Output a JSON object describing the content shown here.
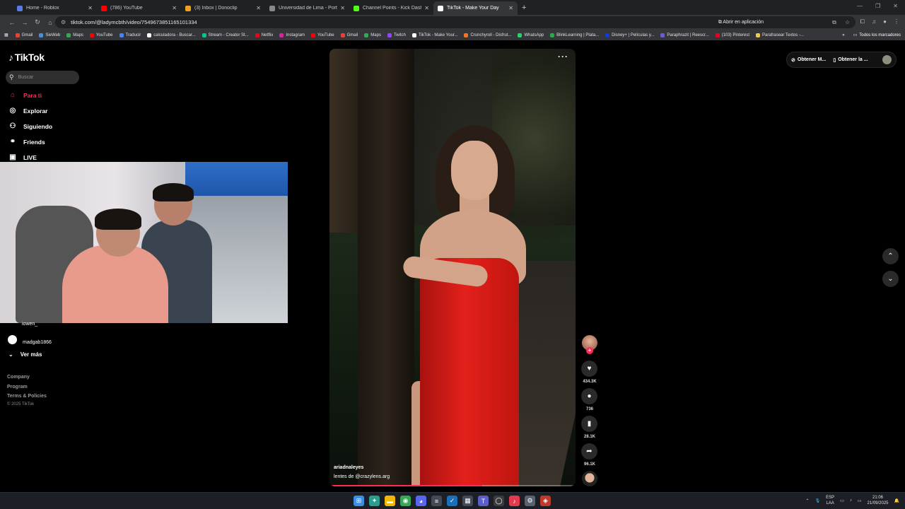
{
  "browser": {
    "tabs": [
      {
        "title": "Home - Roblox",
        "color": "#5a7be0",
        "active": false
      },
      {
        "title": "(786) YouTube",
        "color": "#ff0000",
        "active": false
      },
      {
        "title": "(3) Inbox | Donoclip",
        "color": "#f0a020",
        "active": false
      },
      {
        "title": "Universidad de Lima - Portal de",
        "color": "#888888",
        "active": false
      },
      {
        "title": "Channel Points - Kick Dashboard",
        "color": "#53fc18",
        "active": false
      },
      {
        "title": "TikTok - Make Your Day",
        "color": "#ffffff",
        "active": true
      }
    ],
    "url": "tiktok.com/@ladymcbth/video/7549673851165101334",
    "open_in_app": "Abrir en aplicación",
    "bookmarks": [
      {
        "label": "Gmail",
        "color": "#ea4335"
      },
      {
        "label": "SieWeb",
        "color": "#4a90d9"
      },
      {
        "label": "Maps",
        "color": "#34a853"
      },
      {
        "label": "YouTube",
        "color": "#ff0000"
      },
      {
        "label": "Traducir",
        "color": "#4285f4"
      },
      {
        "label": "calculadora - Buscar...",
        "color": "#ffffff"
      },
      {
        "label": "Stream - Creator St...",
        "color": "#00c88c"
      },
      {
        "label": "Netflix",
        "color": "#e50914"
      },
      {
        "label": "Instagram",
        "color": "#d6249f"
      },
      {
        "label": "YouTube",
        "color": "#ff0000"
      },
      {
        "label": "Gmail",
        "color": "#ea4335"
      },
      {
        "label": "Maps",
        "color": "#34a853"
      },
      {
        "label": "Twitch",
        "color": "#9146ff"
      },
      {
        "label": "TikTok - Make Your...",
        "color": "#ffffff"
      },
      {
        "label": "Crunchyroll - Disfrut...",
        "color": "#f47521"
      },
      {
        "label": "WhatsApp",
        "color": "#25d366"
      },
      {
        "label": "BlinkLearning | Plata...",
        "color": "#2aa84a"
      },
      {
        "label": "Disney+ | Películas y...",
        "color": "#113ccf"
      },
      {
        "label": "Paraphrazit | Reescr...",
        "color": "#6b5bd6"
      },
      {
        "label": "(103) Pinterest",
        "color": "#e60023"
      },
      {
        "label": "Parafrasear Textos -...",
        "color": "#f2c94c"
      }
    ],
    "all_bookmarks": "Todos los marcadores"
  },
  "sidebar": {
    "logo": "TikTok",
    "search_placeholder": "Buscar",
    "nav": [
      {
        "label": "Para ti",
        "icon": "home-icon",
        "glyph": "⌂",
        "active": true
      },
      {
        "label": "Explorar",
        "icon": "compass-icon",
        "glyph": "◎",
        "active": false
      },
      {
        "label": "Siguiendo",
        "icon": "user-follow-icon",
        "glyph": "⚇",
        "active": false
      },
      {
        "label": "Friends",
        "icon": "friends-icon",
        "glyph": "⚭",
        "active": false
      },
      {
        "label": "LIVE",
        "icon": "live-icon",
        "glyph": "▣",
        "active": false
      }
    ],
    "following": [
      {
        "name": "iowen_"
      },
      {
        "name": "madgab1866"
      }
    ],
    "see_more": "Ver más",
    "footer_links": [
      "Company",
      "Program",
      "Terms & Policies"
    ],
    "copyright": "© 2025 TikTok"
  },
  "video": {
    "username": "ariadnaleyes",
    "caption": "lentes de @crazylens.arg",
    "progress_fraction": 0.62
  },
  "actions": {
    "likes": "434.3K",
    "comments": "736",
    "saves": "28.1K",
    "shares": "96.1K"
  },
  "header": {
    "get_coins": "Obtener M...",
    "get_app": "Obtener la ..."
  },
  "taskbar": {
    "apps": [
      {
        "icon": "windows-start-icon",
        "glyph": "⊞",
        "color": "#3a8ee6"
      },
      {
        "icon": "copilot-icon",
        "glyph": "✦",
        "color": "#2a9d8f"
      },
      {
        "icon": "file-explorer-icon",
        "glyph": "▬",
        "color": "#f2b705"
      },
      {
        "icon": "chrome-icon",
        "glyph": "◉",
        "color": "#34a853"
      },
      {
        "icon": "discord-icon",
        "glyph": "◕",
        "color": "#5865f2"
      },
      {
        "icon": "notes-icon",
        "glyph": "≡",
        "color": "#444a55"
      },
      {
        "icon": "steam-icon",
        "glyph": "✓",
        "color": "#1b6fb8"
      },
      {
        "icon": "app-icon",
        "glyph": "▦",
        "color": "#444a55"
      },
      {
        "icon": "teams-icon",
        "glyph": "T",
        "color": "#5b5fc7"
      },
      {
        "icon": "xbox-icon",
        "glyph": "◯",
        "color": "#3c3c3c"
      },
      {
        "icon": "music-icon",
        "glyph": "♪",
        "color": "#e23b4e"
      },
      {
        "icon": "settings-icon",
        "glyph": "⚙",
        "color": "#5a6270"
      },
      {
        "icon": "app-badge-icon",
        "glyph": "◈",
        "color": "#c0392b"
      }
    ],
    "language_top": "ESP",
    "language_bottom": "LAA",
    "time": "21:06",
    "date": "21/09/2025"
  }
}
